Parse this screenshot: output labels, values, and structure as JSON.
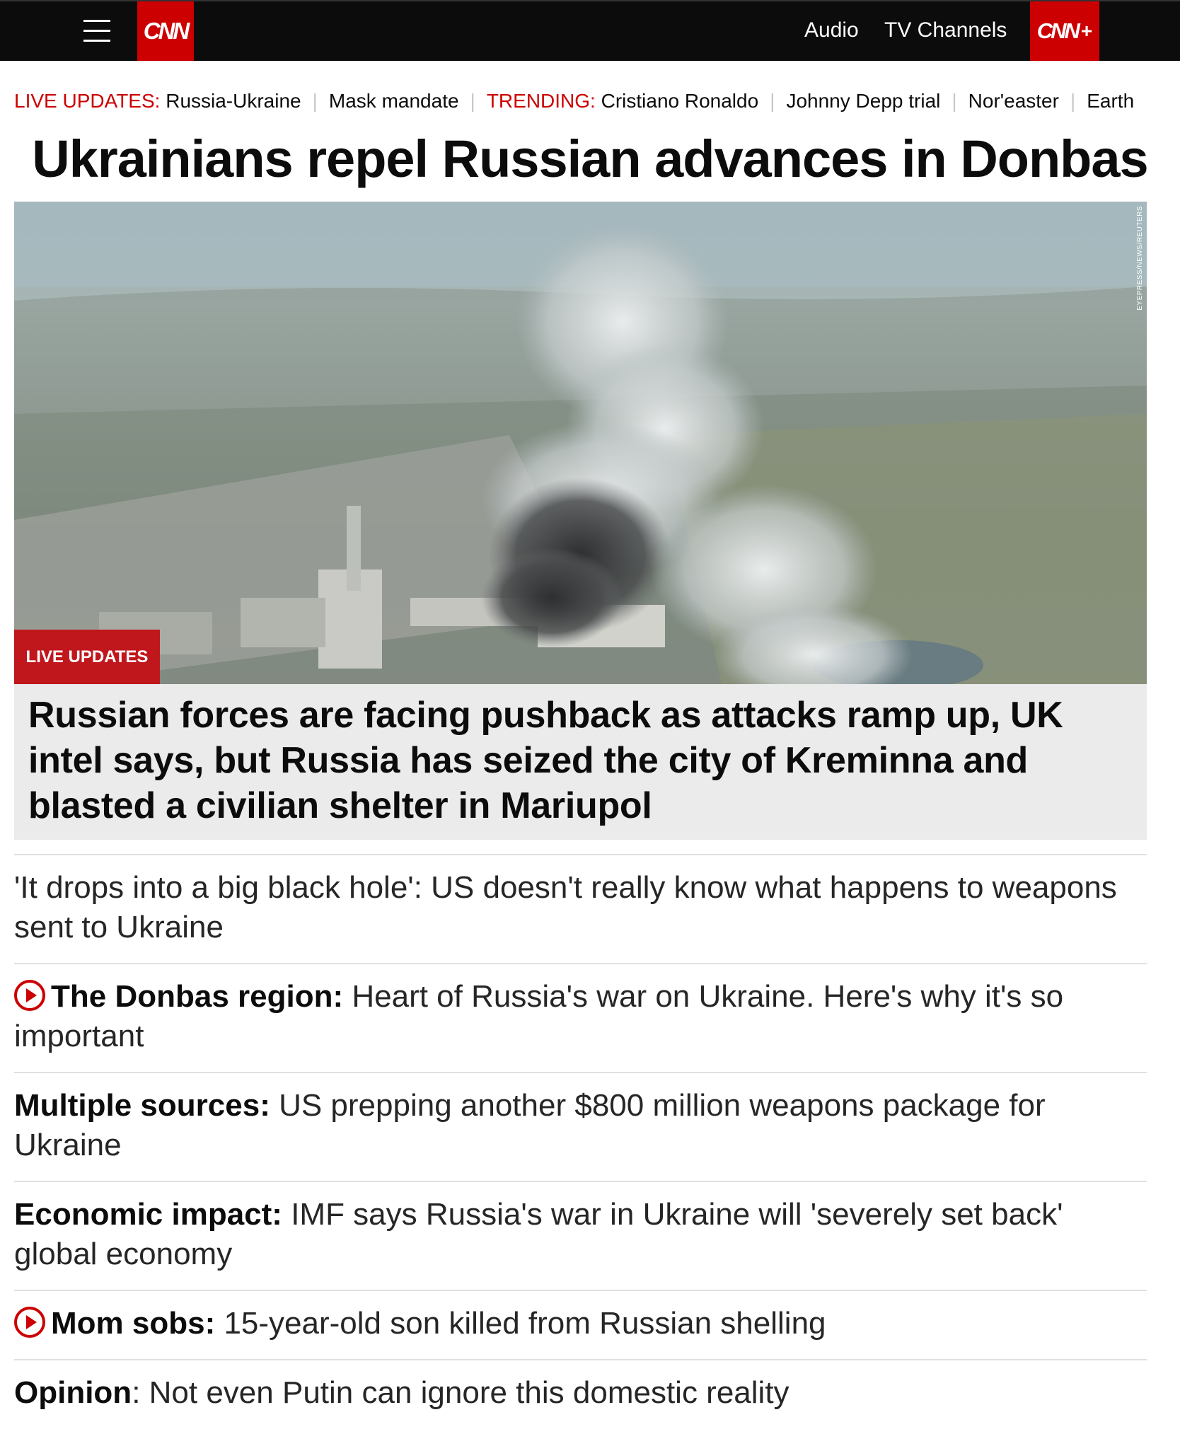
{
  "header": {
    "menu_icon": "hamburger-icon",
    "logo": "CNN",
    "nav": [
      "Audio",
      "TV Channels"
    ],
    "plus_logo": "CNN",
    "plus_symbol": "+"
  },
  "trending": {
    "live_label": "LIVE UPDATES:",
    "live_item": "Russia-Ukraine",
    "item2": "Mask mandate",
    "trending_label": "TRENDING:",
    "items": [
      "Cristiano Ronaldo",
      "Johnny Depp trial",
      "Nor'easter",
      "Earth"
    ]
  },
  "headline": "Ukrainians repel Russian advances in Donbas",
  "hero": {
    "credit": "EYEPRESS/NEWS/REUTERS",
    "badge": "LIVE UPDATES",
    "caption": "Russian forces are facing pushback as attacks ramp up, UK intel says, but Russia has seized the city of Kreminna and blasted a civilian shelter in Mariupol"
  },
  "stories": [
    {
      "bold": "",
      "text": "'It drops into a big black hole': US doesn't really know what happens to weapons sent to Ukraine",
      "video": false
    },
    {
      "bold": "The Donbas region:",
      "text": " Heart of Russia's war on Ukraine. Here's why it's so important",
      "video": true
    },
    {
      "bold": "Multiple sources:",
      "text": " US prepping another $800 million weapons package for Ukraine",
      "video": false
    },
    {
      "bold": "Economic impact:",
      "text": " IMF says Russia's war in Ukraine will 'severely set back' global economy",
      "video": false
    },
    {
      "bold": "Mom sobs:",
      "text": " 15-year-old son killed from Russian shelling",
      "video": true
    },
    {
      "bold": "Opinion",
      "text": ": Not even Putin can ignore this domestic reality",
      "video": false
    }
  ],
  "colors": {
    "brand_red": "#cc0000",
    "topbar": "#0c0c0c",
    "caption_bg": "#ebebeb"
  }
}
